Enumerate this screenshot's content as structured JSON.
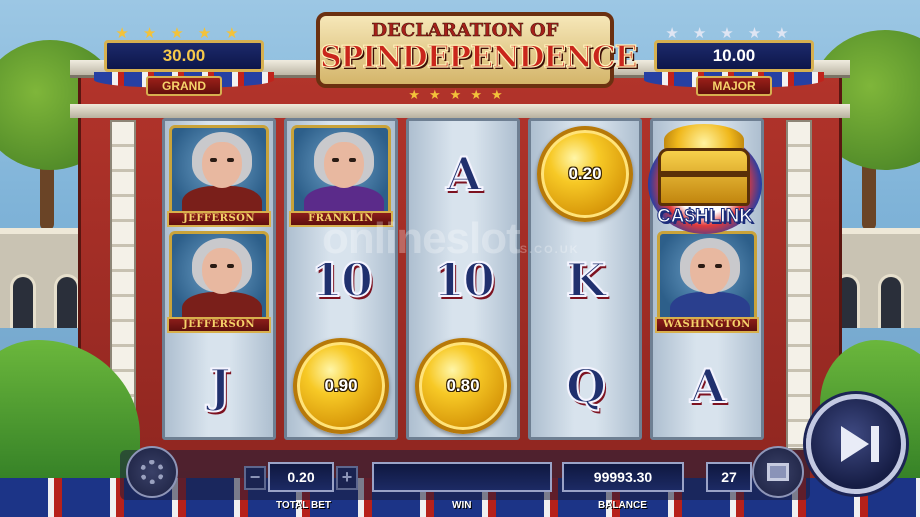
{
  "title": {
    "line1": "DECLARATION OF",
    "line2": "SPINDEPENDENCE"
  },
  "jackpots": {
    "grand": {
      "value": "30.00",
      "label": "GRAND",
      "color": "#f6c94a"
    },
    "major": {
      "value": "10.00",
      "label": "MAJOR",
      "color": "#ffffff"
    }
  },
  "reels": [
    [
      {
        "kind": "portrait",
        "name": "JEFFERSON"
      },
      {
        "kind": "portrait",
        "name": "JEFFERSON"
      },
      {
        "kind": "letter",
        "text": "J"
      }
    ],
    [
      {
        "kind": "portrait",
        "name": "FRANKLIN"
      },
      {
        "kind": "letter",
        "text": "10"
      },
      {
        "kind": "coin",
        "value": "0.90"
      }
    ],
    [
      {
        "kind": "letter",
        "text": "A"
      },
      {
        "kind": "letter",
        "text": "10"
      },
      {
        "kind": "coin",
        "value": "0.80"
      }
    ],
    [
      {
        "kind": "coin",
        "value": "0.20"
      },
      {
        "kind": "letter",
        "text": "K"
      },
      {
        "kind": "letter",
        "text": "Q"
      }
    ],
    [
      {
        "kind": "cashlink"
      },
      {
        "kind": "portrait",
        "name": "WASHINGTON"
      },
      {
        "kind": "letter",
        "text": "A"
      }
    ]
  ],
  "cashlink": {
    "text": "CA$HLINK"
  },
  "watermark": {
    "main": "onlineslot",
    "sub": "S.CO.UK"
  },
  "controls": {
    "bet_value": "0.20",
    "bet_label": "TOTAL BET",
    "minus": "−",
    "plus": "+",
    "win_value": "",
    "win_label": "WIN",
    "balance_value": "99993.30",
    "balance_label": "BALANCE",
    "autoplay_count": "27"
  },
  "icons": {
    "settings": "gear-icon",
    "menu": "menu-icon",
    "spin": "play-skip-icon",
    "star": "star-icon"
  }
}
